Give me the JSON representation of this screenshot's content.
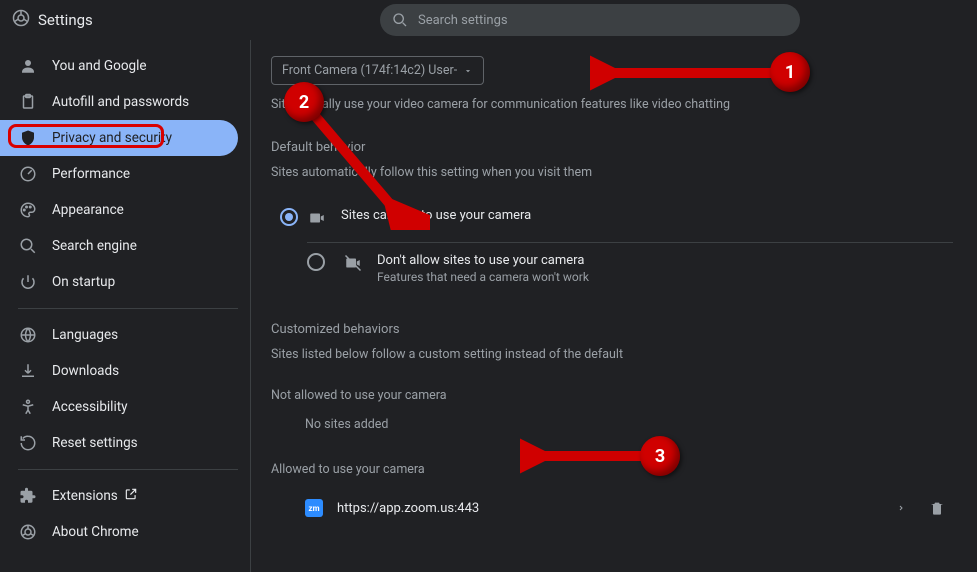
{
  "header": {
    "title": "Settings",
    "search_placeholder": "Search settings"
  },
  "sidebar": {
    "groups": [
      [
        {
          "icon": "person",
          "label": "You and Google"
        },
        {
          "icon": "clipboard",
          "label": "Autofill and passwords"
        },
        {
          "icon": "shield",
          "label": "Privacy and security",
          "active": true
        },
        {
          "icon": "gauge",
          "label": "Performance"
        },
        {
          "icon": "palette",
          "label": "Appearance"
        },
        {
          "icon": "search",
          "label": "Search engine"
        },
        {
          "icon": "power",
          "label": "On startup"
        }
      ],
      [
        {
          "icon": "globe",
          "label": "Languages"
        },
        {
          "icon": "download",
          "label": "Downloads"
        },
        {
          "icon": "accessibility",
          "label": "Accessibility"
        },
        {
          "icon": "reset",
          "label": "Reset settings"
        }
      ],
      [
        {
          "icon": "extension",
          "label": "Extensions",
          "external": true
        },
        {
          "icon": "chrome",
          "label": "About Chrome"
        }
      ]
    ]
  },
  "main": {
    "camera_dropdown": "Front Camera (174f:14c2) User-",
    "camera_help": "Sites usually use your video camera for communication features like video chatting",
    "default_behavior": {
      "title": "Default behavior",
      "sub": "Sites automatically follow this setting when you visit them",
      "options": [
        {
          "label": "Sites can ask to use your camera",
          "desc": "",
          "selected": true,
          "icon": "camera"
        },
        {
          "label": "Don't allow sites to use your camera",
          "desc": "Features that need a camera won't work",
          "selected": false,
          "icon": "camera-off"
        }
      ]
    },
    "custom": {
      "title": "Customized behaviors",
      "sub": "Sites listed below follow a custom setting instead of the default",
      "blocked_title": "Not allowed to use your camera",
      "blocked_empty": "No sites added",
      "allowed_title": "Allowed to use your camera",
      "allowed_sites": [
        {
          "favicon_text": "zm",
          "url": "https://app.zoom.us:443"
        }
      ]
    }
  },
  "annotations": [
    "1",
    "2",
    "3"
  ]
}
